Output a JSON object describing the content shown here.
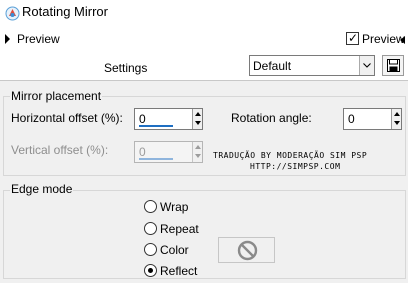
{
  "window": {
    "title": "Rotating Mirror",
    "icon": "app-icon"
  },
  "preview": {
    "label": "Preview",
    "checkbox_label": "Preview",
    "checked": true
  },
  "settings": {
    "label": "Settings",
    "value": "Default",
    "save_icon": "save-icon"
  },
  "mirror_placement": {
    "legend": "Mirror placement",
    "horizontal_offset": {
      "label": "Horizontal offset (%):",
      "value": "0"
    },
    "rotation_angle": {
      "label": "Rotation angle:",
      "value": "0"
    },
    "vertical_offset": {
      "label": "Vertical offset (%):",
      "value": "0",
      "enabled": false
    }
  },
  "credits": {
    "line1": "TRADUÇÃO BY MODERAÇÃO SIM PSP",
    "line2": "HTTP://SIMPSP.COM"
  },
  "edge_mode": {
    "legend": "Edge mode",
    "options": [
      {
        "label": "Wrap",
        "selected": false
      },
      {
        "label": "Repeat",
        "selected": false
      },
      {
        "label": "Color",
        "selected": false
      },
      {
        "label": "Reflect",
        "selected": true
      }
    ],
    "color_swatch_icon": "no-color-icon"
  },
  "colors": {
    "panel_bg": "#f0f0f0",
    "accent": "#1f6fc2"
  }
}
